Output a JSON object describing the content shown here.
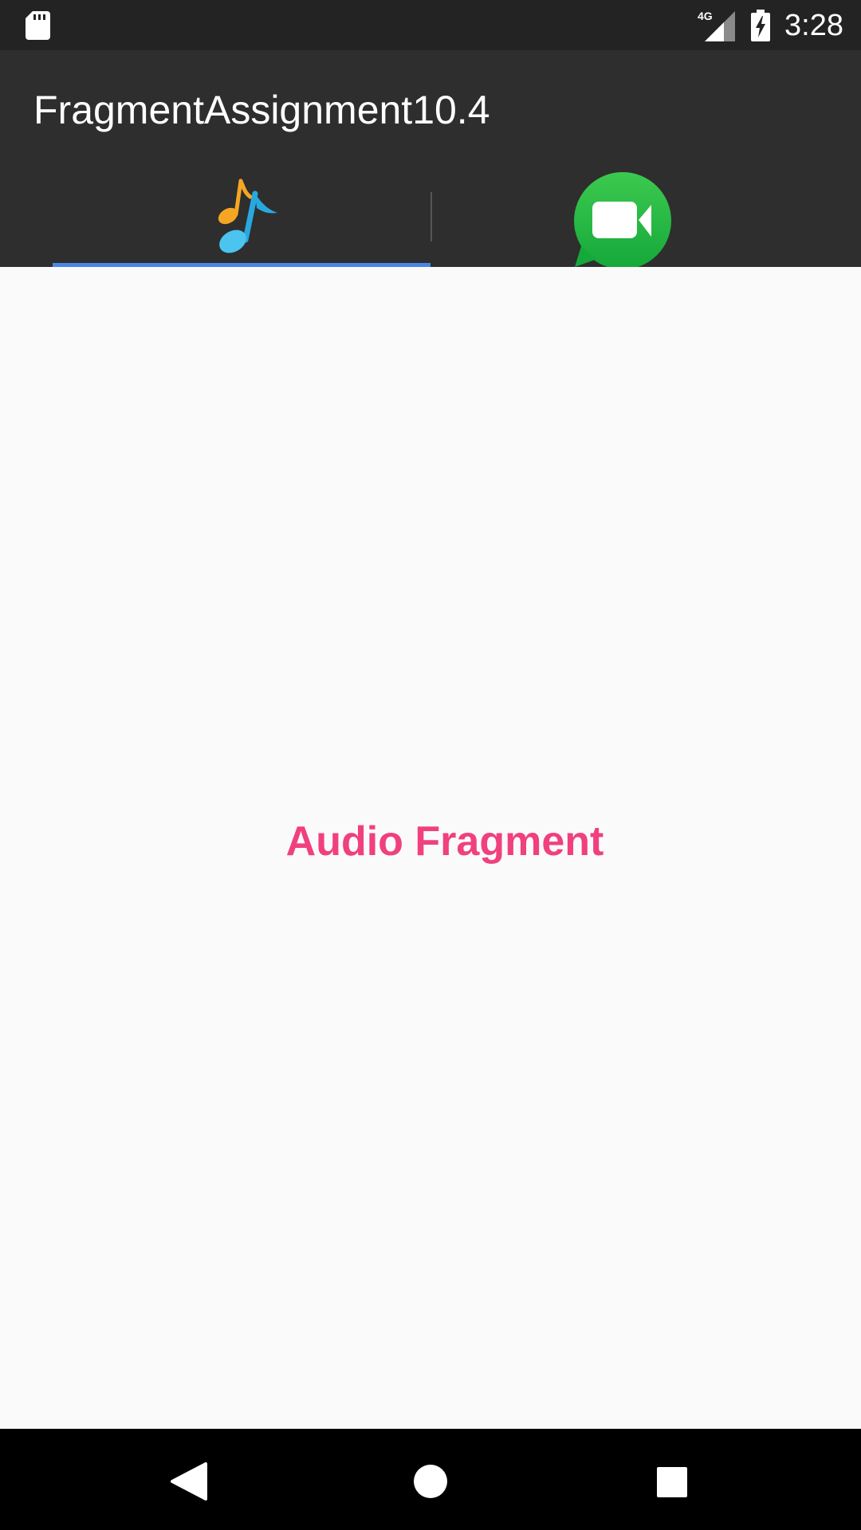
{
  "status_bar": {
    "time": "3:28",
    "network_label": "4G",
    "icons": [
      "sd-card-icon",
      "signal-4g-icon",
      "battery-charging-icon"
    ]
  },
  "app_bar": {
    "title": "FragmentAssignment10.4"
  },
  "tabs": [
    {
      "id": "audio",
      "icon": "music-note-icon",
      "selected": true
    },
    {
      "id": "video",
      "icon": "video-chat-icon",
      "selected": false
    }
  ],
  "content": {
    "label": "Audio Fragment"
  },
  "nav_bar": {
    "buttons": [
      "back-icon",
      "home-icon",
      "recents-icon"
    ]
  },
  "colors": {
    "status_bar_bg": "#232323",
    "app_bar_bg": "#2e2e2e",
    "tab_indicator": "#4a86e8",
    "label_color": "#f0407e",
    "content_bg": "#fafafa",
    "nav_bar_bg": "#000000",
    "video_icon_green": "#1fba45"
  }
}
